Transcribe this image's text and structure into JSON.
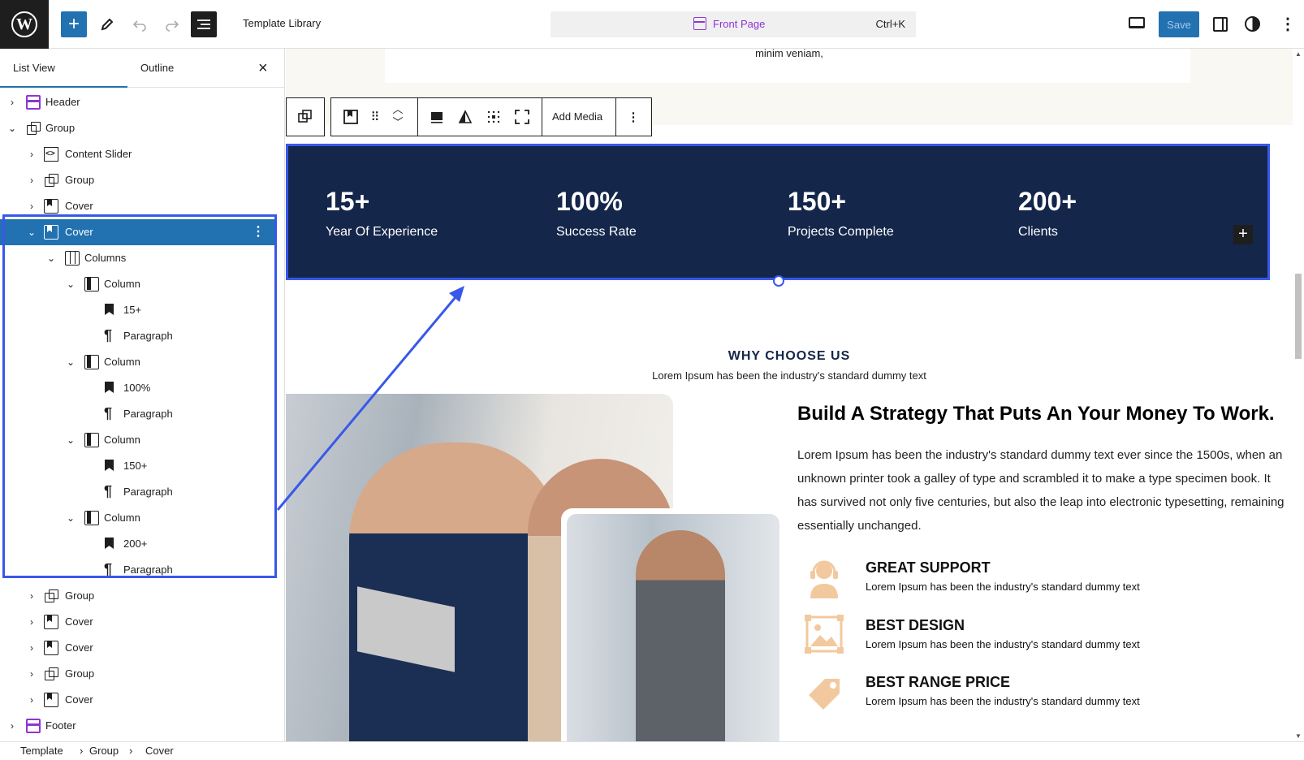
{
  "topbar": {
    "doc_title": "Template Library",
    "command": {
      "label": "Front Page",
      "shortcut": "Ctrl+K"
    },
    "save_label": "Save",
    "accent": "#2271b1",
    "command_color": "#8c36d3"
  },
  "sidebar": {
    "tabs": [
      {
        "label": "List View"
      },
      {
        "label": "Outline"
      }
    ],
    "close_icon": "close-icon",
    "tree": [
      {
        "label": "Header"
      },
      {
        "label": "Group"
      },
      {
        "label": "Content Slider"
      },
      {
        "label": "Group"
      },
      {
        "label": "Cover"
      },
      {
        "label": "Cover"
      },
      {
        "label": "Columns"
      },
      {
        "label": "Column"
      },
      {
        "label": "15+"
      },
      {
        "label": "Paragraph"
      },
      {
        "label": "Column"
      },
      {
        "label": "100%"
      },
      {
        "label": "Paragraph"
      },
      {
        "label": "Column"
      },
      {
        "label": "150+"
      },
      {
        "label": "Paragraph"
      },
      {
        "label": "Column"
      },
      {
        "label": "200+"
      },
      {
        "label": "Paragraph"
      },
      {
        "label": "Group"
      },
      {
        "label": "Cover"
      },
      {
        "label": "Cover"
      },
      {
        "label": "Group"
      },
      {
        "label": "Cover"
      },
      {
        "label": "Footer"
      }
    ]
  },
  "canvas": {
    "top_text": "minim veniam,",
    "block_toolbar": {
      "add_media": "Add Media"
    },
    "stats": [
      {
        "num": "15+",
        "label": "Year Of Experience"
      },
      {
        "num": "100%",
        "label": "Success Rate"
      },
      {
        "num": "150+",
        "label": "Projects Complete"
      },
      {
        "num": "200+",
        "label": "Clients"
      }
    ],
    "stats_bg": "#14264a",
    "selection_color": "#3858e9",
    "why_title": "WHY CHOOSE US",
    "why_sub": "Lorem Ipsum has been the industry's standard dummy text",
    "heading": "Build A Strategy That Puts An Your Money To Work.",
    "paragraph": "Lorem Ipsum has been the industry's standard dummy text ever since the 1500s, when an unknown printer took a galley of type and scrambled it to make a type specimen book. It has survived not only five centuries, but also the leap into electronic typesetting, remaining essentially unchanged.",
    "features": [
      {
        "title": "GREAT SUPPORT",
        "desc": "Lorem Ipsum has been the industry's standard dummy text",
        "icon": "headset-icon"
      },
      {
        "title": "BEST DESIGN",
        "desc": "Lorem Ipsum has been the industry's standard dummy text",
        "icon": "image-icon"
      },
      {
        "title": "BEST RANGE PRICE",
        "desc": "Lorem Ipsum has been the industry's standard dummy text",
        "icon": "price-tag-icon"
      }
    ]
  },
  "breadcrumb": [
    "Template",
    "Group",
    "Cover"
  ]
}
